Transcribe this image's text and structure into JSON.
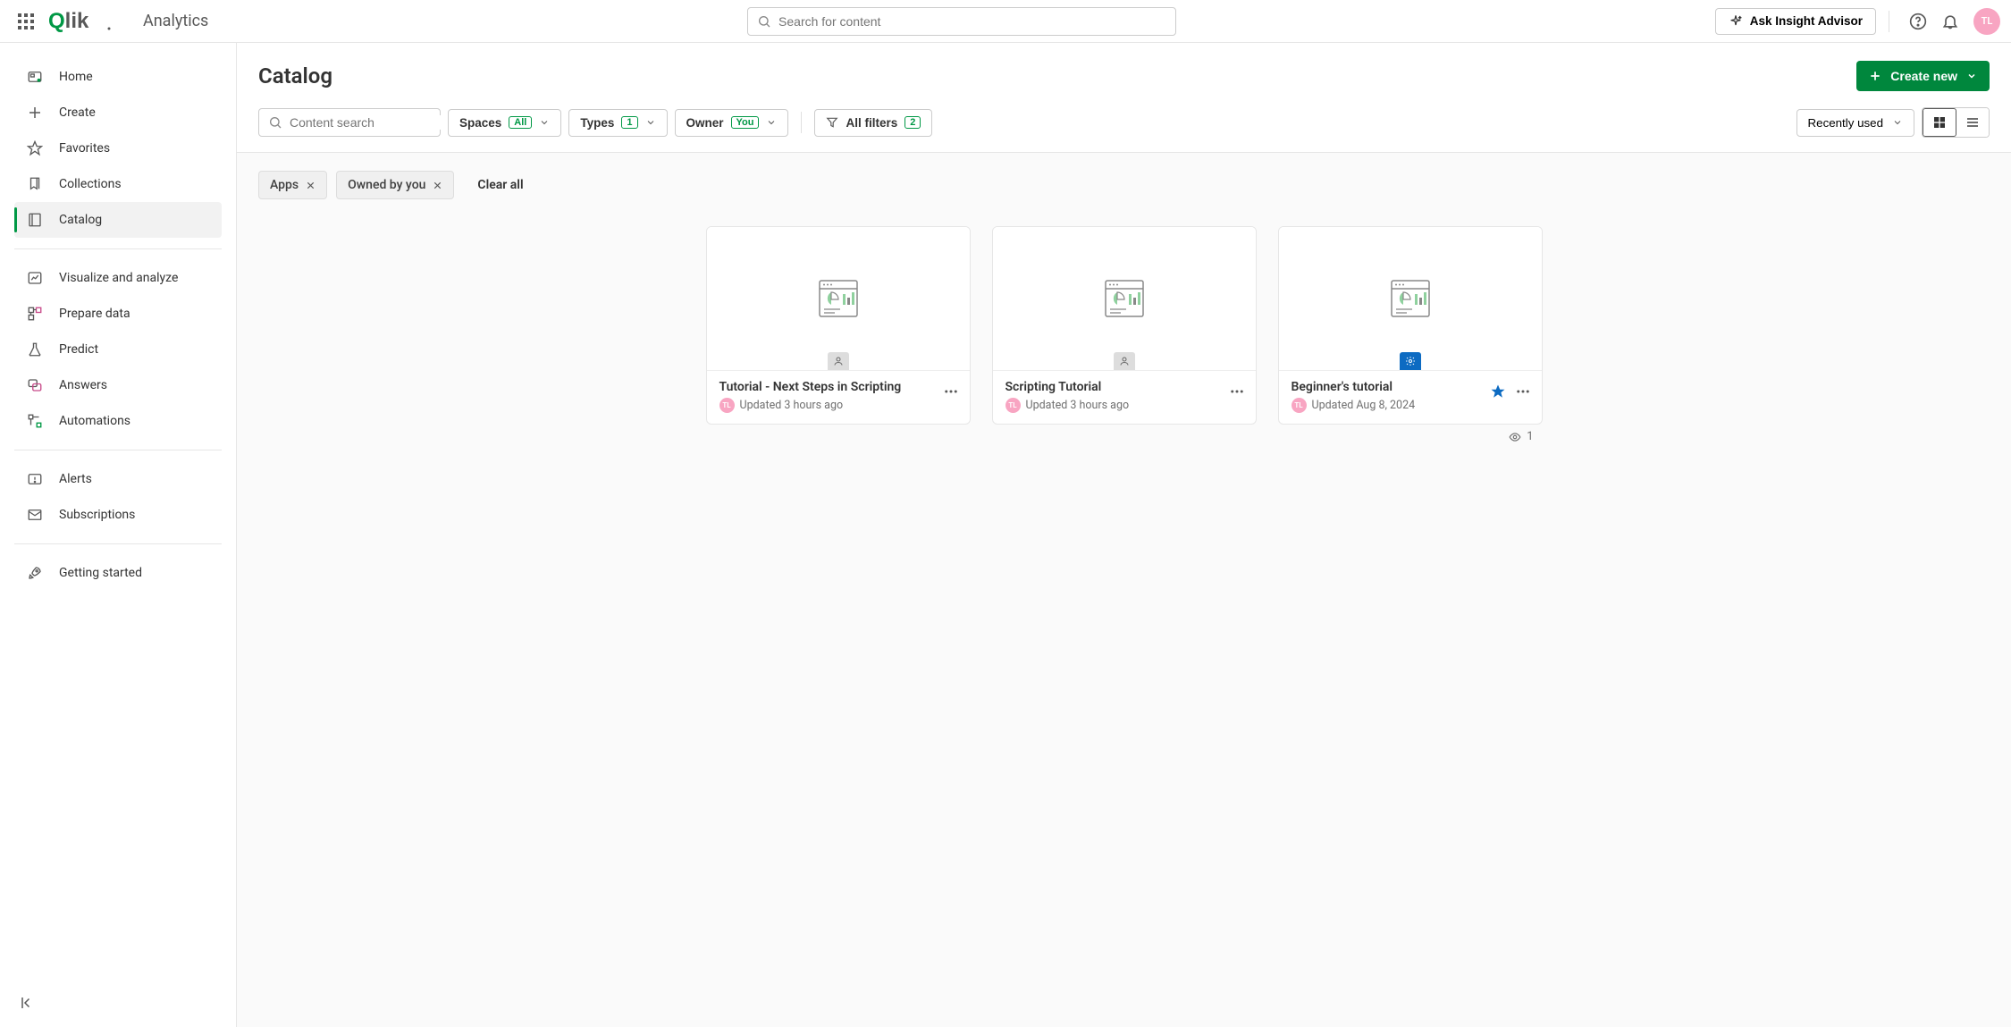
{
  "header": {
    "brand": "Analytics",
    "search_placeholder": "Search for content",
    "ask_label": "Ask Insight Advisor",
    "avatar_initials": "TL"
  },
  "sidebar": {
    "items": [
      {
        "label": "Home"
      },
      {
        "label": "Create"
      },
      {
        "label": "Favorites"
      },
      {
        "label": "Collections"
      },
      {
        "label": "Catalog"
      },
      {
        "label": "Visualize and analyze"
      },
      {
        "label": "Prepare data"
      },
      {
        "label": "Predict"
      },
      {
        "label": "Answers"
      },
      {
        "label": "Automations"
      },
      {
        "label": "Alerts"
      },
      {
        "label": "Subscriptions"
      },
      {
        "label": "Getting started"
      }
    ]
  },
  "main": {
    "title": "Catalog",
    "create_label": "Create new",
    "content_search_placeholder": "Content search",
    "filters": {
      "spaces": {
        "label": "Spaces",
        "badge": "All"
      },
      "types": {
        "label": "Types",
        "badge": "1"
      },
      "owner": {
        "label": "Owner",
        "badge": "You"
      },
      "all": {
        "label": "All filters",
        "badge": "2"
      }
    },
    "sort_label": "Recently used",
    "chips": [
      {
        "label": "Apps"
      },
      {
        "label": "Owned by you"
      }
    ],
    "clear_all": "Clear all",
    "cards": [
      {
        "title": "Tutorial - Next Steps in Scripting",
        "meta": "Updated 3 hours ago",
        "avatar": "TL",
        "badge_type": "grey",
        "starred": false,
        "views": null
      },
      {
        "title": "Scripting Tutorial",
        "meta": "Updated 3 hours ago",
        "avatar": "TL",
        "badge_type": "grey",
        "starred": false,
        "views": null
      },
      {
        "title": "Beginner's tutorial",
        "meta": "Updated Aug 8, 2024",
        "avatar": "TL",
        "badge_type": "blue",
        "starred": true,
        "views": "1"
      }
    ]
  }
}
